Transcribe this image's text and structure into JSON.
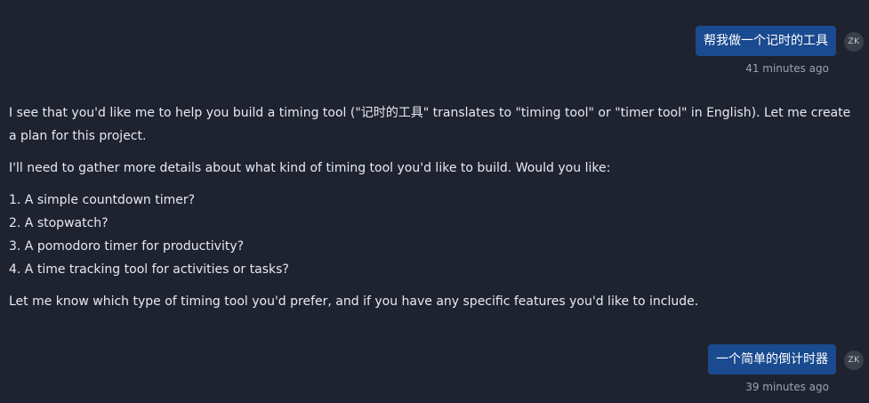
{
  "messages": {
    "user1": {
      "text": "帮我做一个记时的工具",
      "avatar": "ZK",
      "timestamp": "41 minutes ago"
    },
    "assistant": {
      "intro": "I see that you'd like me to help you build a timing tool (\"记时的工具\" translates to \"timing tool\" or \"timer tool\" in English). Let me create a plan for this project.",
      "question": "I'll need to gather more details about what kind of timing tool you'd like to build. Would you like:",
      "options": [
        "1. A simple countdown timer?",
        "2. A stopwatch?",
        "3. A pomodoro timer for productivity?",
        "4. A time tracking tool for activities or tasks?"
      ],
      "closing": "Let me know which type of timing tool you'd prefer, and if you have any specific features you'd like to include."
    },
    "user2": {
      "text": "一个简单的倒计时器",
      "avatar": "ZK",
      "timestamp": "39 minutes ago"
    }
  }
}
